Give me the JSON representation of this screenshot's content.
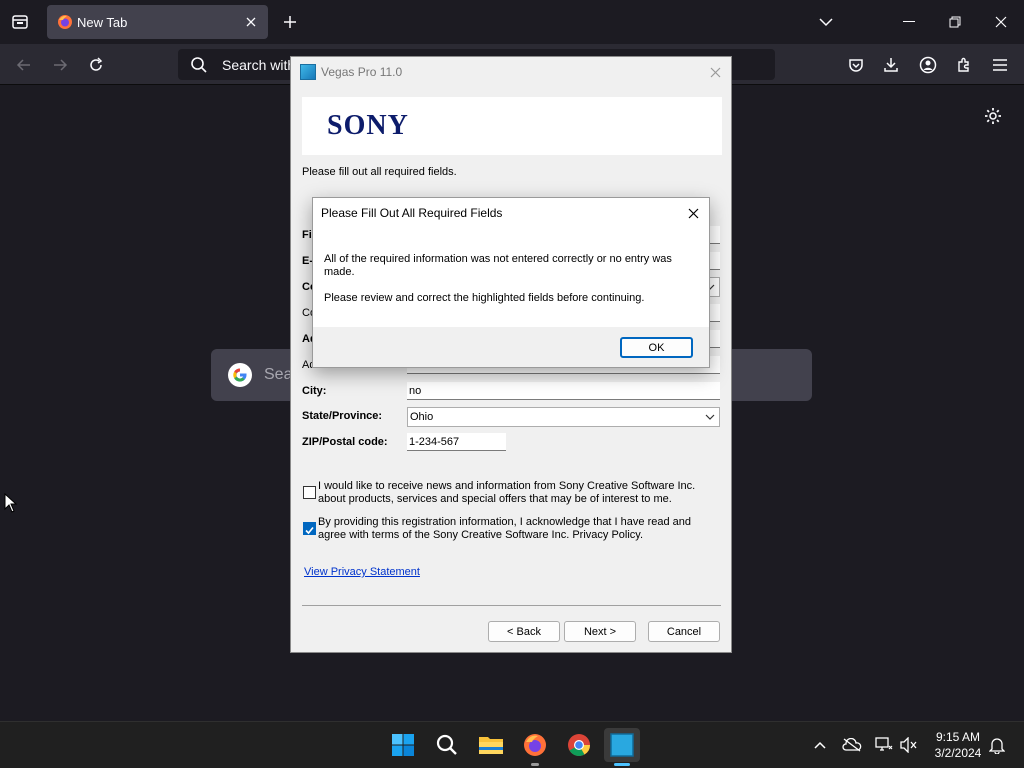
{
  "browser": {
    "tab_title": "New Tab",
    "urlbar_placeholder": "Search with",
    "newtab_search_placeholder": "Sea"
  },
  "vegas": {
    "window_title": "Vegas Pro 11.0",
    "banner_logo": "SONY",
    "instructions": "Please fill out all required fields.",
    "partial_labels": [
      "Fi",
      "E-",
      "Co",
      "Co",
      "Ad",
      "Ad"
    ],
    "city_label": "City:",
    "city_value": "no",
    "state_label": "State/Province:",
    "state_value": "Ohio",
    "zip_label": "ZIP/Postal code:",
    "zip_value": "1-234-567",
    "news_checkbox_label": "I would like to receive news and information from Sony Creative Software Inc. about products, services and special offers that may be of interest to me.",
    "news_checked": false,
    "agree_checkbox_label": "By providing this registration information, I acknowledge that I have read and agree with terms of the Sony Creative Software Inc. Privacy Policy.",
    "agree_checked": true,
    "privacy_link": "View Privacy Statement",
    "back_button": "< Back",
    "next_button": "Next >",
    "cancel_button": "Cancel"
  },
  "alert": {
    "title": "Please Fill Out All Required Fields",
    "message_1": "All of the required information was not entered correctly or no entry was made.",
    "message_2": "Please review and correct the highlighted fields before continuing.",
    "ok_button": "OK"
  },
  "taskbar": {
    "time": "9:15 AM",
    "date": "3/2/2024",
    "icons": [
      "windows-start-icon",
      "search-icon",
      "file-explorer-icon",
      "firefox-icon",
      "chrome-icon",
      "vegas-app-icon"
    ]
  },
  "colors": {
    "accent": "#0067c0",
    "browser_bg": "#1c1b22",
    "sony_blue": "#0d1c6b"
  }
}
